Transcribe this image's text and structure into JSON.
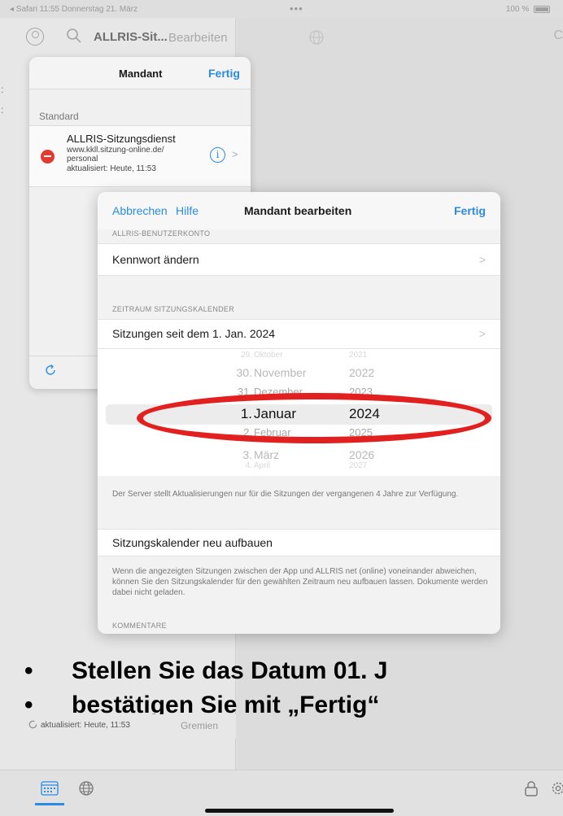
{
  "status_bar": {
    "left": "◂ Safari  11:55  Donnerstag 21. März",
    "dots": "•••",
    "right": "100 %"
  },
  "top_nav": {
    "app_title": "ALLRIS-Sit...",
    "edit": "Bearbeiten"
  },
  "popover": {
    "title": "Mandant",
    "done": "Fertig",
    "section": "Standard",
    "item": {
      "name": "ALLRIS-Sitzungsdienst",
      "url": "www.kkll.sitzung-online.de/",
      "user": "personal",
      "updated": "aktualisiert: Heute, 11:53"
    }
  },
  "modal": {
    "cancel": "Abbrechen",
    "help": "Hilfe",
    "title": "Mandant bearbeiten",
    "done": "Fertig",
    "account_header": "ALLRIS-BENUTZERKONTO",
    "change_password": "Kennwort ändern",
    "calendar_header": "ZEITRAUM SITZUNGSKALENDER",
    "sessions_since": "Sitzungen seit dem 1. Jan. 2024",
    "picker": {
      "days": [
        "29.",
        "30.",
        "31.",
        "1.",
        "2.",
        "3.",
        "4."
      ],
      "months": [
        "Oktober",
        "November",
        "Dezember",
        "Januar",
        "Februar",
        "März",
        "April"
      ],
      "years": [
        "2021",
        "2022",
        "2023",
        "2024",
        "2025",
        "2026",
        "2027"
      ],
      "selected_index": 3
    },
    "server_note": "Der Server stellt Aktualisierungen nur für die Sitzungen der vergangenen 4 Jahre zur Verfügung.",
    "rebuild": "Sitzungskalender neu aufbauen",
    "rebuild_note": "Wenn die angezeigten Sitzungen zwischen der App und ALLRIS net (online) voneinander abweichen, können Sie den Sitzungskalender für den gewählten Zeitraum neu aufbauen lassen. Dokumente werden dabei nicht geladen.",
    "comments_header": "KOMMENTARE"
  },
  "instructions": {
    "bullet": "•",
    "line1": "Stellen Sie das Datum 01. J",
    "line2": "bestätigen Sie mit „Fertig“"
  },
  "left_footer": {
    "updated": "aktualisiert: Heute, 11:53",
    "committees": "Gremien"
  },
  "colors": {
    "accent": "#2a8be6",
    "highlight_ring": "#e2201f",
    "delete": "#e4392f"
  }
}
